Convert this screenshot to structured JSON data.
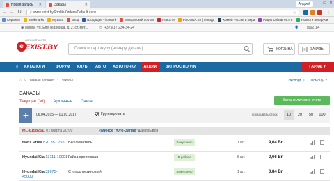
{
  "browser": {
    "tabs": [
      {
        "title": "Новая запись",
        "active": false
      },
      {
        "title": "Заказы",
        "active": true
      }
    ],
    "user": "Андрей",
    "url": "www.exist.by/Profile/Orders/Default.aspx",
    "bookmarks": [
      {
        "label": "Сервисы",
        "color": "#5b8bd0"
      },
      {
        "label": "Bookmarks",
        "color": "#f0b400"
      },
      {
        "label": "Музыка",
        "color": "#f0b400"
      },
      {
        "label": "Вход",
        "color": "#e74c3c"
      },
      {
        "label": "Входящие - hotmark",
        "color": "#2b579a"
      },
      {
        "label": "Белорусский портал",
        "color": "#e74c3c"
      },
      {
        "label": "Новости",
        "color": "#d11f25"
      },
      {
        "label": "POGODA.BY | Погода",
        "color": "#f39c12"
      },
      {
        "label": "Хоккей России и мира",
        "color": "#2c3e50"
      },
      {
        "label": "Радио Unistar 99.5 F",
        "color": "#8e44ad"
      },
      {
        "label": "Новости Беларуси",
        "color": "#27ae60"
      }
    ]
  },
  "site": {
    "util": {
      "address": "Минск, ул. Епе Гедройца, д. 2, ст. мет...",
      "phone": "+375(17)234-34-24",
      "account": "7962184"
    },
    "logo": {
      "sub": "АВТОЗАПЧАСТИ",
      "main": "EXIST.BY",
      "letter": "e"
    },
    "search_placeholder": "Поиск по артикулу (номеру детали)",
    "cart_label": "КОРЗИНА",
    "orders_label": "ЗАКАЗЫ",
    "nav": [
      "КАТАЛОГИ",
      "ФОРУМ",
      "КЛУБ",
      "АВТО",
      "АВТОТОЧКИ",
      "АКЦИИ",
      "ЗАПРОС ПО VIN"
    ],
    "garage": "ГАРАЖ",
    "breadcrumbs": [
      "Личный кабинет",
      "Заказы"
    ],
    "export": "Экспорт",
    "help": "Помощь",
    "page_title": "ЗАКАЗЫ",
    "order_tabs": [
      "Текущие (36)",
      "Архивные",
      "Счета"
    ],
    "balance_btn": "Баланс личного счета",
    "filter": {
      "plus": "+",
      "date_range": "06.04.2015 — 01.03.2017",
      "group_label": "Группировать",
      "per_page_label": "показывать строк:",
      "per_page": [
        "10",
        "20",
        "50",
        "100"
      ]
    },
    "order": {
      "number": "ML-0158261,",
      "date": "01 марта 20:09",
      "store": "«Минск \"Юго-Запад\"»,",
      "city": "Самовывоз"
    },
    "rows": [
      {
        "brand": "Hans Pries",
        "code": "820 357 755",
        "code2": "",
        "desc": "Выключатель",
        "status": "Выкуплено",
        "qty": "1 шт.",
        "price": "9,64 Br"
      },
      {
        "brand": "Hyundai/Kia",
        "code": "13111-10001",
        "code2": "",
        "desc": "Гайка крепежная",
        "status": "В работе",
        "qty": "8 шт.",
        "price": "0,66 Br"
      },
      {
        "brand": "Hyundai/Kia",
        "code": "32675-",
        "code2": "45000",
        "desc": "Стопор резиновый",
        "status": "Выкуплено",
        "qty": "1 шт.",
        "price": "0,84 Br"
      }
    ]
  }
}
